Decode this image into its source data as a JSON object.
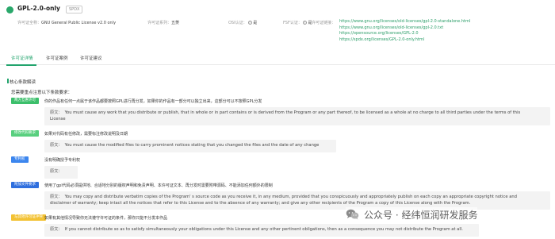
{
  "header": {
    "title": "GPL-2.0-only",
    "badge": "SPDX",
    "meta": [
      {
        "label": "许可证全称：",
        "value": "GNU General Public License v2.0 only"
      },
      {
        "label": "许可证系列：",
        "value": "五菱"
      },
      {
        "label": "OSI认证：",
        "value": "是"
      },
      {
        "label": "FSF认证：",
        "value": "是"
      },
      {
        "label": "许可证链接：",
        "value": ""
      }
    ],
    "links": [
      "https://www.gnu.org/licenses/old-licenses/gpl-2.0-standalone.html",
      "https://www.gnu.org/licenses/old-licenses/gpl-2.0.txt",
      "https://opensource.org/licenses/GPL-2.0",
      "https://spdx.org/licenses/GPL-2.0-only.html"
    ]
  },
  "tabs": [
    "许可证详情",
    "许可证案例",
    "许可证建议"
  ],
  "section": {
    "title": "核心条款解读",
    "subhead": "您需要重点注意以下条款要求："
  },
  "clauses": [
    {
      "tag": "两方互惠许可",
      "desc": "你的作品有任何一点属于该作品都要按照GPL进行再分发，如果你的作品有一部分可以独立出来，这部分可以不按照GPL分发",
      "quote_label": "原文：",
      "quote": [
        "You must cause any work that you distribute or publish, that in whole or in part contains or is derived from the Program or any part thereof, to be licensed as a whole at no charge to all third parties under the terms of this",
        "License"
      ]
    },
    {
      "tag": "修改代码要求",
      "desc": "如果对代码有任修改，需要标注修改说明及日期",
      "quote_label": "原文：",
      "quote": [
        "You must cause the modified files to carry prominent notices stating that you changed the files and the date of any change"
      ]
    },
    {
      "tag": "专利权",
      "desc": "没有明确授予专利权",
      "quote_label": "原文：",
      "quote": [
        ""
      ]
    },
    {
      "tag": "附加文件要求",
      "desc": "使用了gpl代码必须提供地、合适地分别的版权声明和免责声明、本许可证文本、再分发时需要附带源码、不能添加任何额外的限制",
      "quote_label": "原文：",
      "quote": [
        "You may copy and distribute verbatim copies of the Program' s source code as you receive it, in any medium, provided that you conspicuously and appropriately publish on each copy an appropriate copyright notice and",
        "disclaimer of warranty; keep intact all the notices that refer to this License and to the absence of any warranty; and give any other recipients of the Program a copy of this License along with the Program."
      ]
    },
    {
      "tag": "与其他许可证冲突",
      "desc": "如果有其他情况导致你无法遵守许可证的条件，那你只能不分发本作品",
      "quote_label": "原文：",
      "quote": [
        "If you cannot distribute so as to satisfy simultaneously your obligations under this License and any other pertinent obligations, then as a consequence you may not distribute the Program at all."
      ]
    }
  ],
  "watermark": {
    "text": "公众号 · 经纬恒润研发服务",
    "icon": "wechat-icon"
  },
  "colors": {
    "accent": "#22a46d",
    "link": "#2a9d68",
    "tag_green": "#3cbf6b",
    "tag_blue": "#3c86ee",
    "tag_yellow": "#f3c233"
  }
}
